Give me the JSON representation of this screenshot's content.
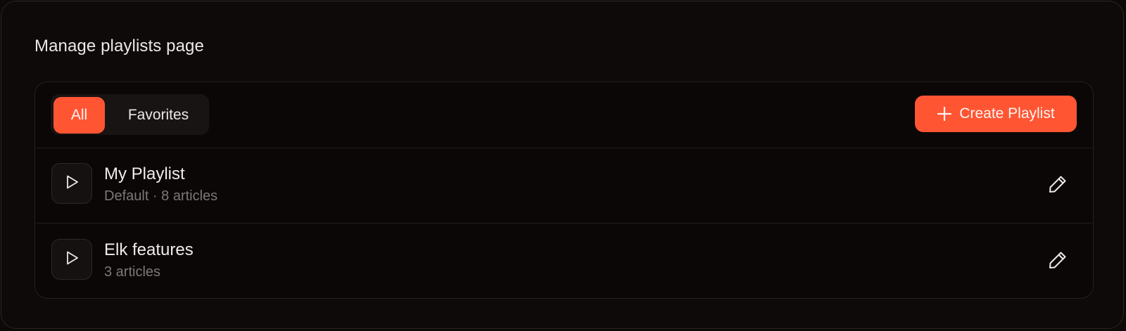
{
  "page": {
    "title": "Manage playlists page"
  },
  "tabs": [
    {
      "label": "All",
      "active": true
    },
    {
      "label": "Favorites",
      "active": false
    }
  ],
  "toolbar": {
    "create_label": "Create Playlist",
    "create_icon": "plus-icon"
  },
  "playlists": [
    {
      "title": "My Playlist",
      "subtitle": "Default · 8 articles",
      "play_icon": "play-icon",
      "edit_icon": "pencil-icon"
    },
    {
      "title": "Elk features",
      "subtitle": "3 articles",
      "play_icon": "play-icon",
      "edit_icon": "pencil-icon"
    }
  ],
  "colors": {
    "accent": "#ff5533",
    "background": "#0c0908",
    "text": "#ece8e6",
    "muted": "#7d7876"
  }
}
